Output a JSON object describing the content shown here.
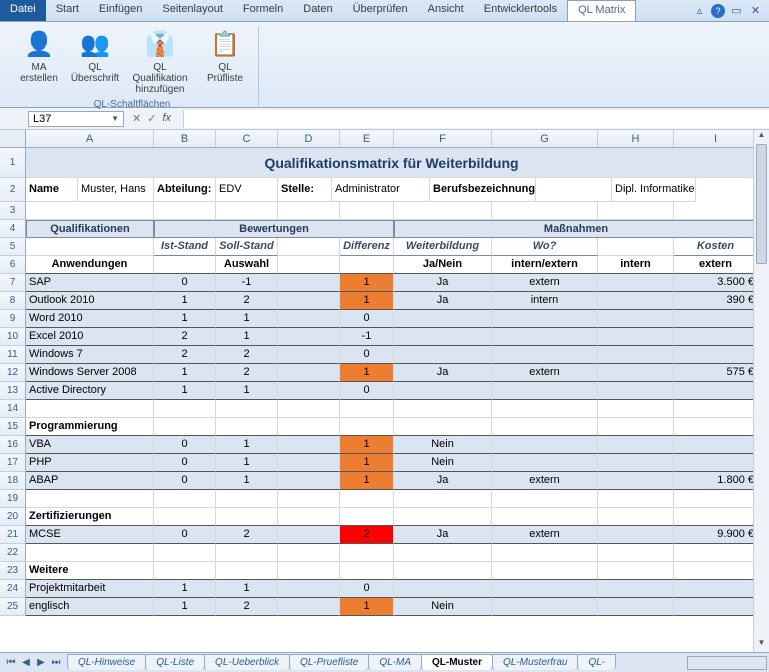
{
  "ribbon": {
    "tabs": [
      "Datei",
      "Start",
      "Einfügen",
      "Seitenlayout",
      "Formeln",
      "Daten",
      "Überprüfen",
      "Ansicht",
      "Entwicklertools",
      "QL Matrix"
    ],
    "active_tab": "QL Matrix",
    "group_label": "QL-Schaltflächen",
    "buttons": [
      {
        "label": "MA erstellen",
        "icon": "👤"
      },
      {
        "label": "QL Überschrift",
        "icon": "👥"
      },
      {
        "label": "QL Qualifikation hinzufügen",
        "icon": "👔"
      },
      {
        "label": "QL Prüfliste",
        "icon": "📋"
      }
    ]
  },
  "name_box": "L37",
  "title": "Qualifikationsmatrix für Weiterbildung",
  "info": {
    "name_label": "Name",
    "name": "Muster, Hans",
    "abt_label": "Abteilung:",
    "abt": "EDV",
    "stelle_label": "Stelle:",
    "stelle": "Administrator",
    "beruf_label": "Berufsbezeichnung:",
    "beruf": "Dipl. Informatiker"
  },
  "headers": {
    "qual": "Qualifikationen",
    "bew": "Bewertungen",
    "mass": "Maßnahmen",
    "ist": "Ist-Stand",
    "soll": "Soll-Stand",
    "diff": "Differenz",
    "weiter": "Weiterbildung",
    "wo": "Wo?",
    "kosten": "Kosten",
    "anw": "Anwendungen",
    "auswahl": "Auswahl",
    "janein": "Ja/Nein",
    "intext": "intern/extern",
    "intern": "intern",
    "extern": "extern"
  },
  "sections": [
    {
      "title": "Anwendungen",
      "rows": [
        {
          "r": 7,
          "name": "SAP",
          "ist": "0",
          "soll": "-1",
          "diff": "1",
          "diffc": "orange",
          "jn": "Ja",
          "wo": "extern",
          "kost": "3.500 €"
        },
        {
          "r": 8,
          "name": "Outlook 2010",
          "ist": "1",
          "soll": "2",
          "diff": "1",
          "diffc": "orange",
          "jn": "Ja",
          "wo": "intern",
          "kost": "390 €"
        },
        {
          "r": 9,
          "name": "Word 2010",
          "ist": "1",
          "soll": "1",
          "diff": "0"
        },
        {
          "r": 10,
          "name": "Excel 2010",
          "ist": "2",
          "soll": "1",
          "diff": "-1"
        },
        {
          "r": 11,
          "name": "Windows 7",
          "ist": "2",
          "soll": "2",
          "diff": "0"
        },
        {
          "r": 12,
          "name": "Windows Server 2008",
          "ist": "1",
          "soll": "2",
          "diff": "1",
          "diffc": "orange",
          "jn": "Ja",
          "wo": "extern",
          "kost": "575 €"
        },
        {
          "r": 13,
          "name": "Active Directory",
          "ist": "1",
          "soll": "1",
          "diff": "0"
        }
      ]
    },
    {
      "title": "Programmierung",
      "head_r": 15,
      "rows": [
        {
          "r": 16,
          "name": "VBA",
          "ist": "0",
          "soll": "1",
          "diff": "1",
          "diffc": "orange",
          "jn": "Nein"
        },
        {
          "r": 17,
          "name": "PHP",
          "ist": "0",
          "soll": "1",
          "diff": "1",
          "diffc": "orange",
          "jn": "Nein"
        },
        {
          "r": 18,
          "name": "ABAP",
          "ist": "0",
          "soll": "1",
          "diff": "1",
          "diffc": "orange",
          "jn": "Ja",
          "wo": "extern",
          "kost": "1.800 €"
        }
      ]
    },
    {
      "title": "Zertifizierungen",
      "head_r": 20,
      "rows": [
        {
          "r": 21,
          "name": "MCSE",
          "ist": "0",
          "soll": "2",
          "diff": "2",
          "diffc": "red",
          "jn": "Ja",
          "wo": "extern",
          "kost": "9.900 €"
        }
      ]
    },
    {
      "title": "Weitere",
      "head_r": 23,
      "rows": [
        {
          "r": 24,
          "name": "Projektmitarbeit",
          "ist": "1",
          "soll": "1",
          "diff": "0"
        },
        {
          "r": 25,
          "name": "englisch",
          "ist": "1",
          "soll": "2",
          "diff": "1",
          "diffc": "orange",
          "jn": "Nein"
        }
      ]
    }
  ],
  "blank_rows": [
    3,
    14,
    19,
    22
  ],
  "columns": [
    "A",
    "B",
    "C",
    "D",
    "E",
    "F",
    "G",
    "H",
    "I"
  ],
  "sheet_tabs": [
    "QL-Hinweise",
    "QL-Liste",
    "QL-Ueberblick",
    "QL-Pruefliste",
    "QL-MA",
    "QL-Muster",
    "QL-Musterfrau",
    "QL-"
  ],
  "active_sheet": "QL-Muster"
}
